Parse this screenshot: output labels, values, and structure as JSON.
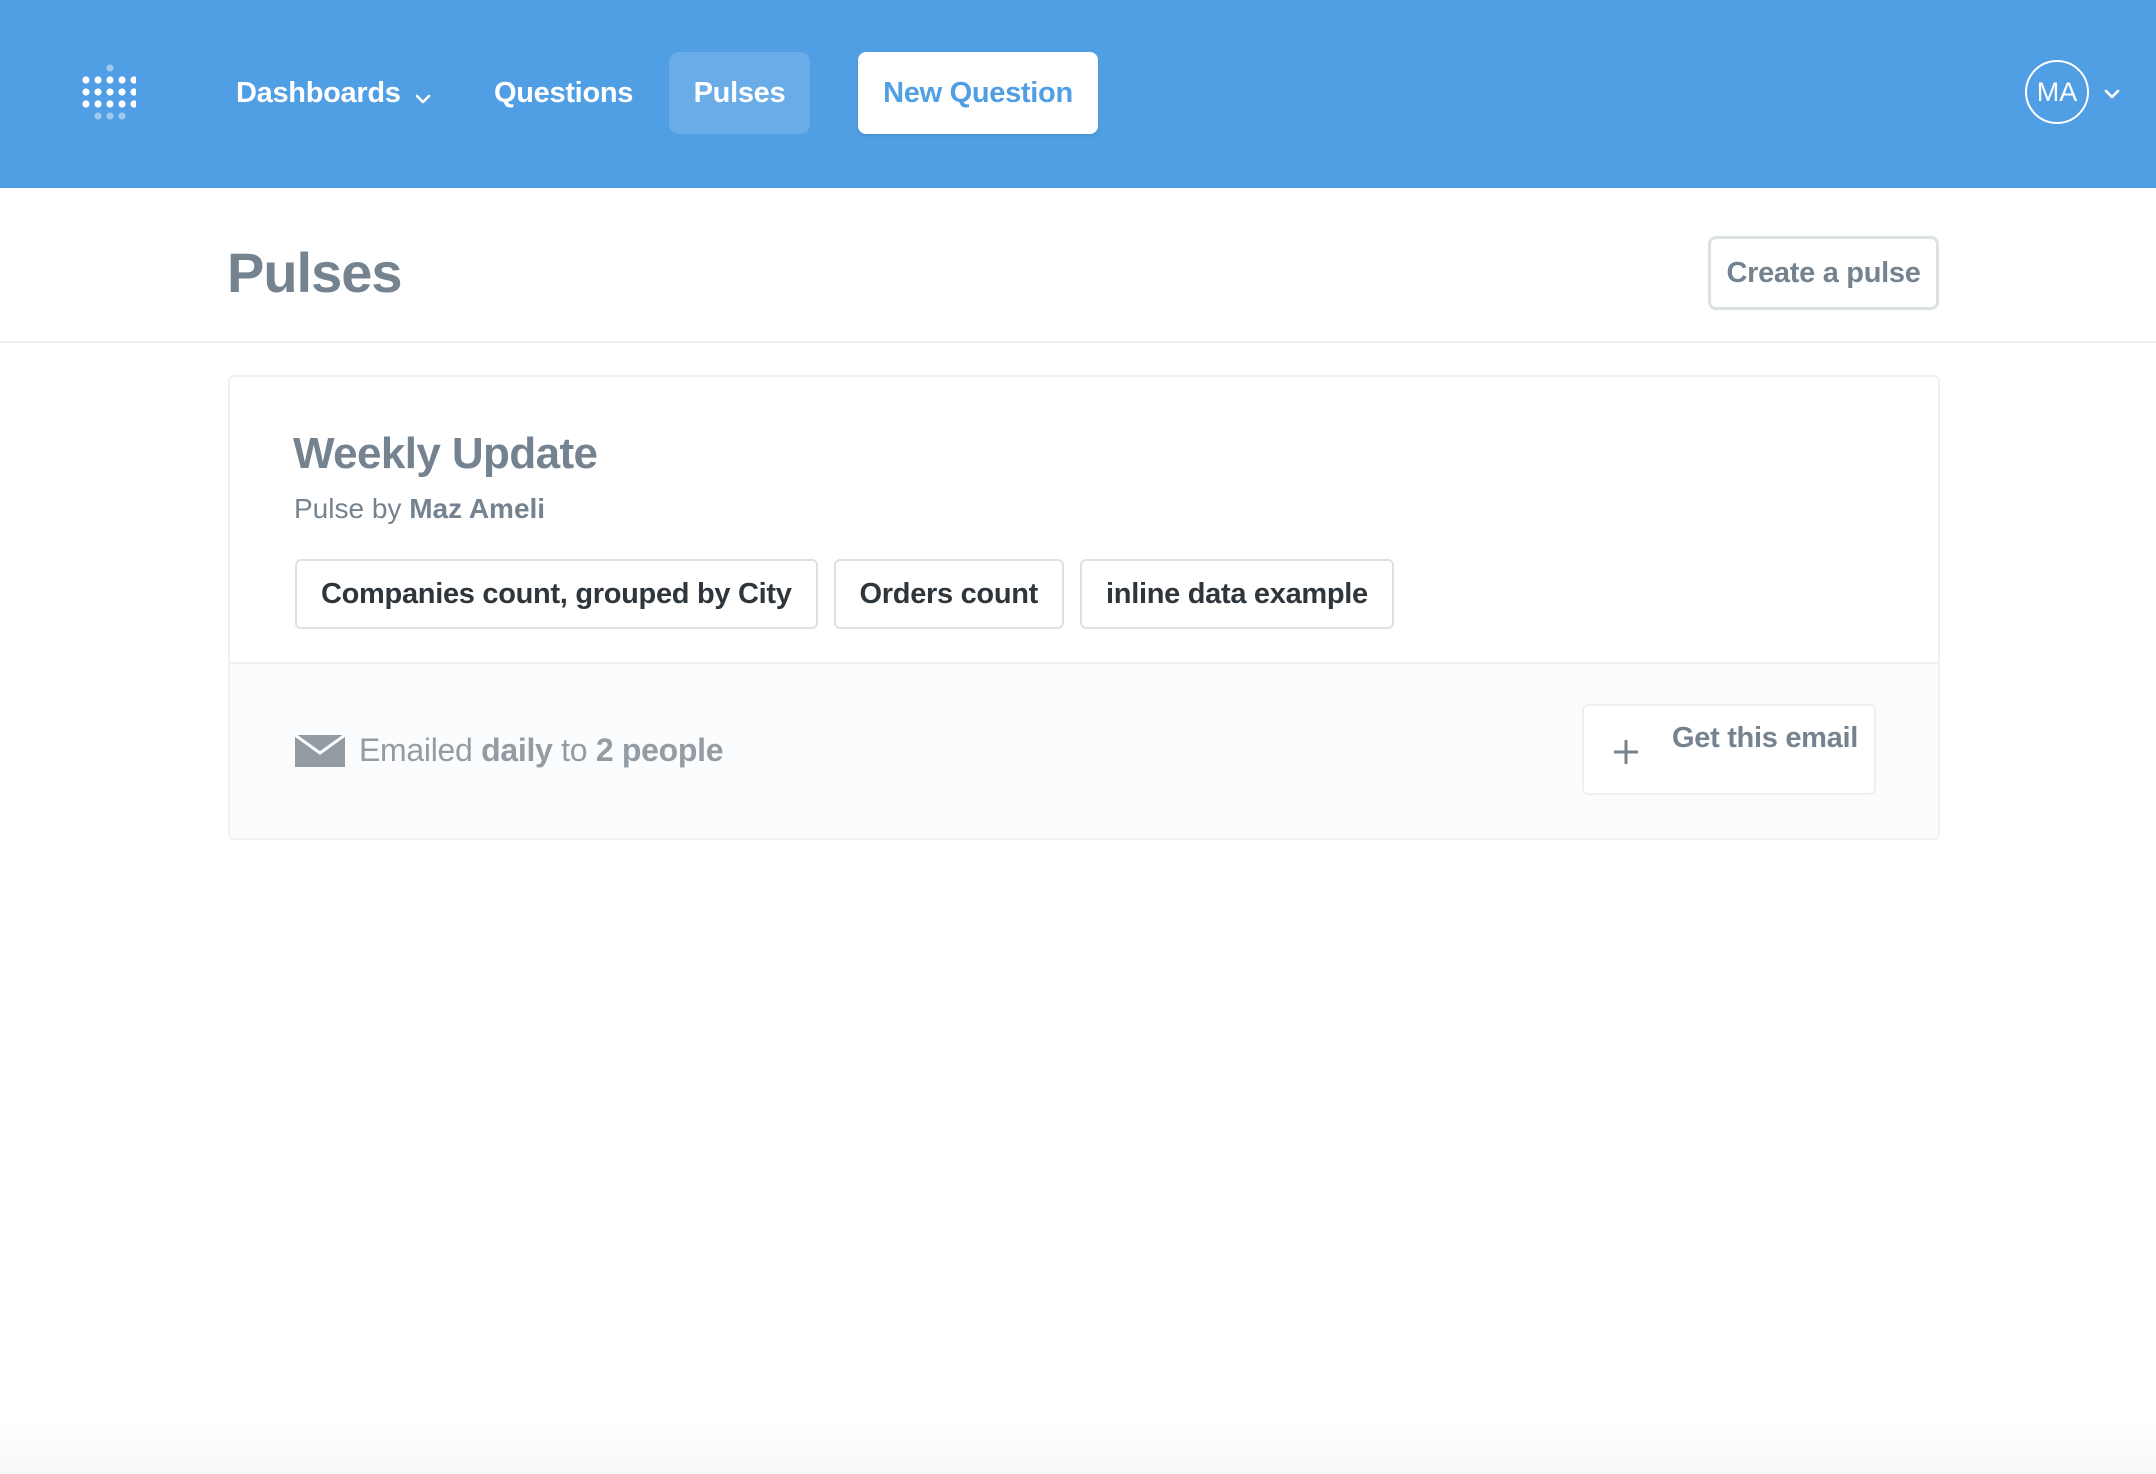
{
  "nav": {
    "logo_icon": "metabase-logo-icon",
    "dashboards_label": "Dashboards",
    "questions_label": "Questions",
    "pulses_label": "Pulses",
    "new_question_label": "New Question",
    "user_initials": "MA",
    "active_item": "Pulses"
  },
  "header": {
    "title": "Pulses",
    "create_label": "Create a pulse"
  },
  "pulse": {
    "name": "Weekly Update",
    "by_prefix": "Pulse by",
    "creator": "Maz Ameli",
    "cards": [
      "Companies count, grouped by City",
      "Orders count",
      "inline data example"
    ],
    "schedule": {
      "prefix": "Emailed",
      "frequency": "daily",
      "mid": "to",
      "recipients": "2 people"
    },
    "get_email_label": "Get this email"
  },
  "colors": {
    "brand": "#509ee3",
    "text_medium": "#74838f",
    "text_dark": "#2e353b",
    "border": "#dce1e4"
  }
}
